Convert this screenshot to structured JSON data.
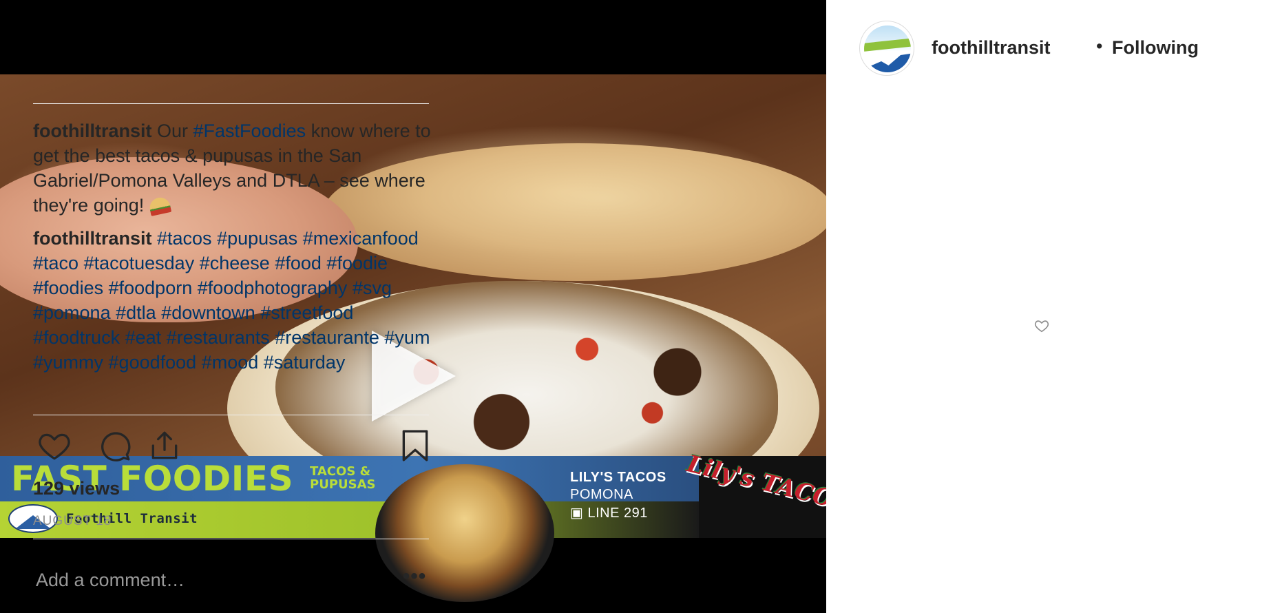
{
  "post": {
    "username": "foothilltransit",
    "separator": "•",
    "follow_status": "Following",
    "caption": {
      "username": "foothilltransit",
      "text_1": "Our ",
      "hashtag_1": "#FastFoodies",
      "text_2": " know where to get the best tacos & pupusas in the San Gabriel/Pomona Valleys and DTLA – see where they're going! "
    },
    "comment": {
      "username": "foothilltransit",
      "hashtags": [
        "#tacos",
        "#pupusas",
        "#mexicanfood",
        "#taco",
        "#tacotuesday",
        "#cheese",
        "#food",
        "#foodie",
        "#foodies",
        "#foodporn",
        "#foodphotography",
        "#svg",
        "#pomona",
        "#dtla",
        "#downtown",
        "#streetfood",
        "#foodtruck",
        "#eat",
        "#restaurants",
        "#restaurante",
        "#yum",
        "#yummy",
        "#goodfood",
        "#mood",
        "#saturday"
      ]
    },
    "views": "129 views",
    "date": "AUGUST 18",
    "comment_placeholder": "Add a comment…",
    "more_label": "•••"
  },
  "video": {
    "banner_title": "FAST FOODIES",
    "banner_subtitle": "TACOS & PUPUSAS",
    "brand_name": "Foothill Transit",
    "restaurant_name": "LILY'S TACOS",
    "restaurant_city": "POMONA",
    "restaurant_line": "LINE 291",
    "restaurant_logo": "Lily's TACOS"
  },
  "colors": {
    "hashtag": "#003569",
    "text": "#262626",
    "muted": "#8e8e8e",
    "divider": "#efefef",
    "banner_green": "#b9dd3a",
    "banner_blue": "#3d74b3"
  },
  "icons": {
    "play": "play-icon",
    "like": "heart-icon",
    "comment": "comment-bubble-icon",
    "share": "share-icon",
    "save": "bookmark-icon",
    "comment_like": "heart-icon",
    "more": "more-dots-icon"
  }
}
